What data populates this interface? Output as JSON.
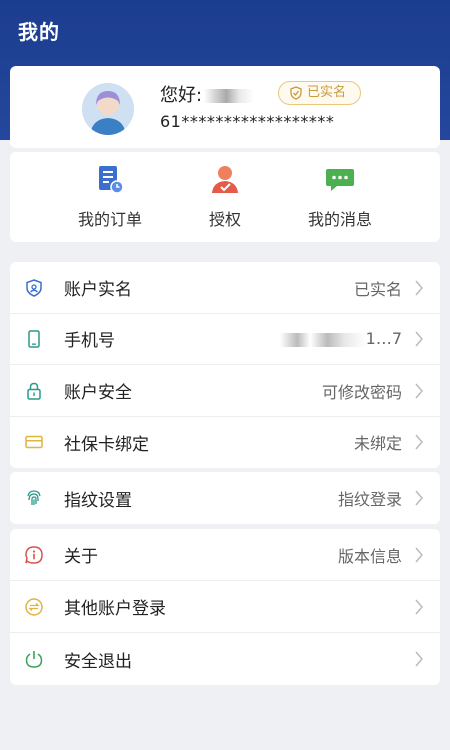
{
  "page": {
    "title": "我的"
  },
  "profile": {
    "greeting": "您好:",
    "verified_label": "已实名",
    "id_number": "61******************"
  },
  "actions": [
    {
      "label": "我的订单",
      "icon": "order-icon"
    },
    {
      "label": "授权",
      "icon": "authorize-icon"
    },
    {
      "label": "我的消息",
      "icon": "message-icon"
    }
  ],
  "settings": {
    "group1": [
      {
        "label": "账户实名",
        "value": "已实名",
        "icon": "shield-id-icon"
      },
      {
        "label": "手机号",
        "value": "1…7",
        "icon": "phone-icon"
      },
      {
        "label": "账户安全",
        "value": "可修改密码",
        "icon": "lock-icon"
      },
      {
        "label": "社保卡绑定",
        "value": "未绑定",
        "icon": "card-icon"
      }
    ],
    "group2": [
      {
        "label": "指纹设置",
        "value": "指纹登录",
        "icon": "fingerprint-icon"
      }
    ],
    "group3": [
      {
        "label": "关于",
        "value": "版本信息",
        "icon": "info-icon"
      },
      {
        "label": "其他账户登录",
        "value": "",
        "icon": "switch-account-icon"
      },
      {
        "label": "安全退出",
        "value": "",
        "icon": "power-icon"
      }
    ]
  },
  "colors": {
    "header_blue": "#1c3d8f",
    "badge_gold": "#c99a3a",
    "icon_teal": "#2a9a8a",
    "icon_red": "#d9534f",
    "icon_yellow": "#e0b440"
  }
}
